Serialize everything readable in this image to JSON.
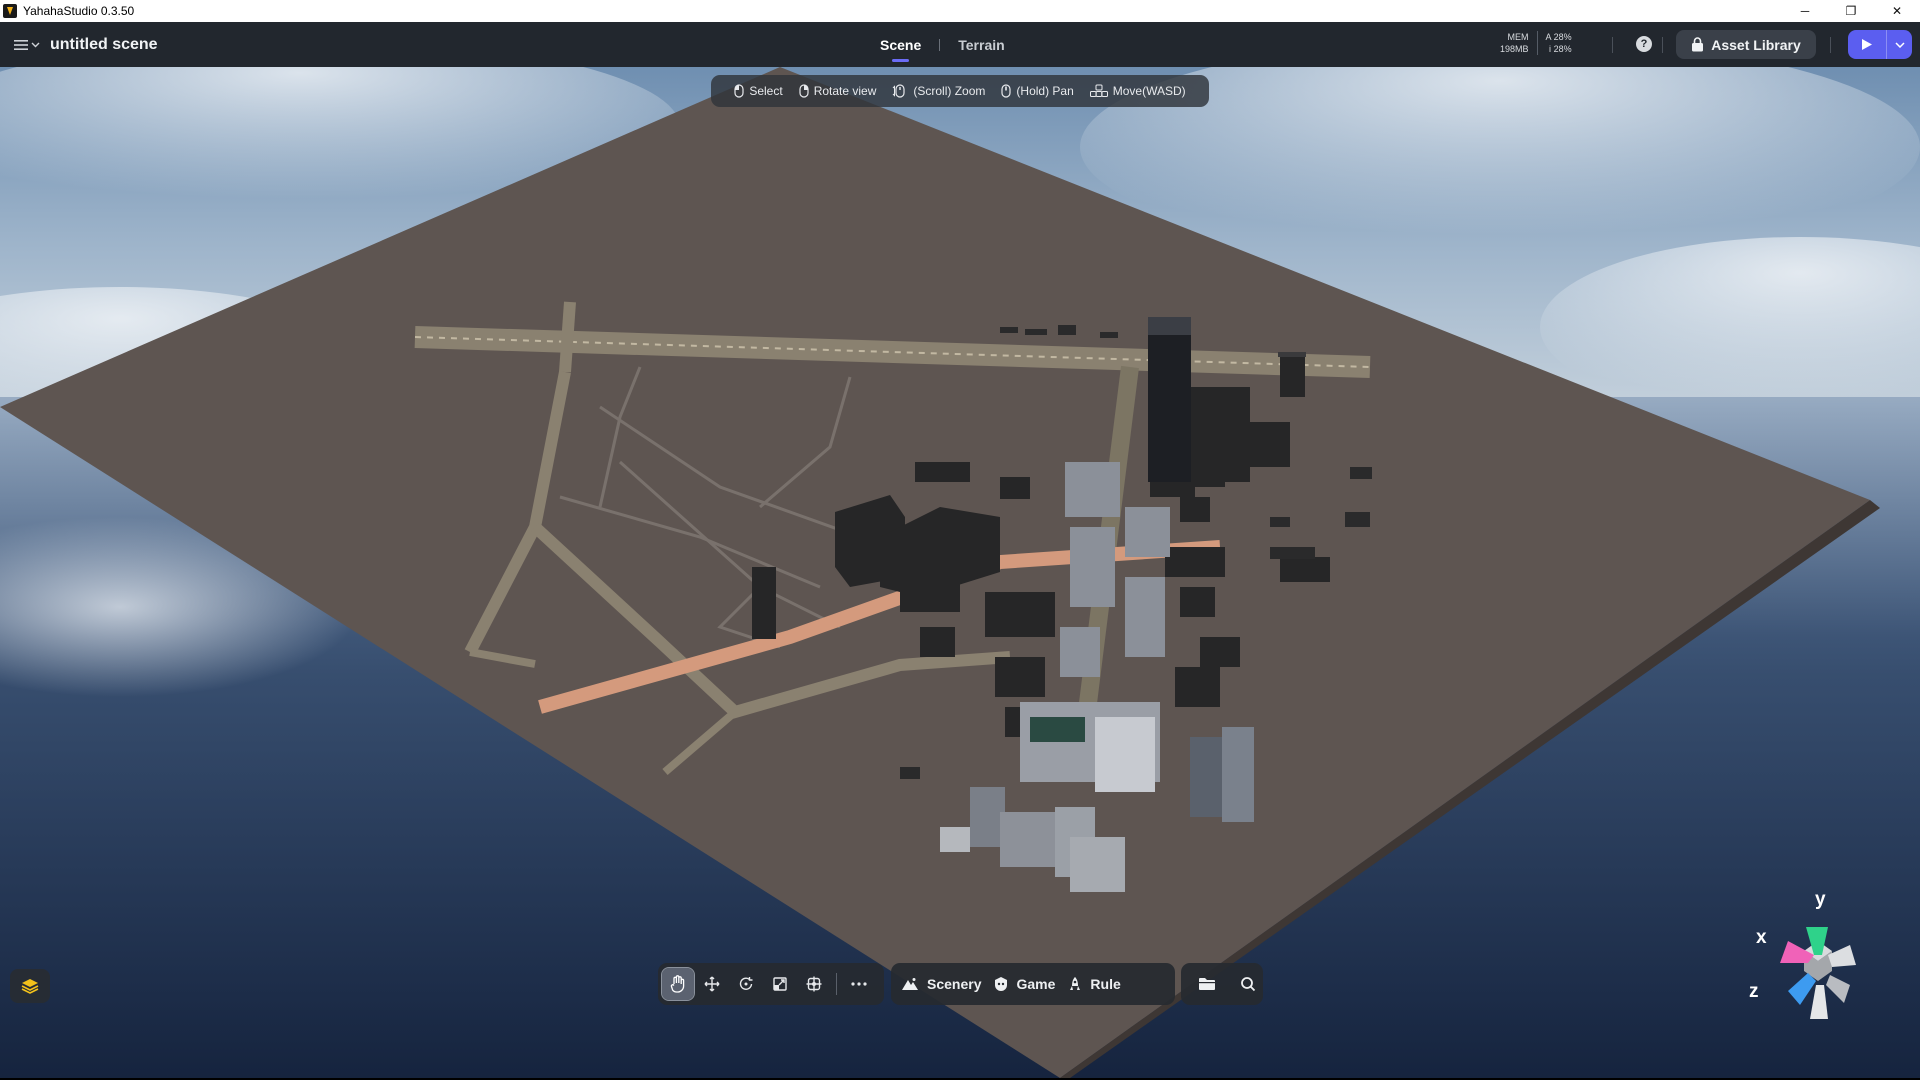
{
  "window": {
    "title": "YahahaStudio 0.3.50",
    "controls": [
      "─",
      "❐",
      "✕"
    ]
  },
  "header": {
    "scene_name": "untitled scene",
    "tabs": [
      {
        "label": "Scene",
        "active": true
      },
      {
        "label": "Terrain",
        "active": false
      }
    ],
    "stats": {
      "mem_label": "MEM",
      "mem_value": "198MB",
      "cpu_label": "A",
      "cpu_value": "28%",
      "gpu_label": "i",
      "gpu_value": "28%"
    },
    "help_label": "?",
    "asset_library_label": "Asset Library",
    "accent_color": "#5b5ef0"
  },
  "hints": [
    {
      "icon": "mouse-left-icon",
      "label": "Select"
    },
    {
      "icon": "mouse-right-icon",
      "label": "Rotate view"
    },
    {
      "icon": "mouse-scroll-icon",
      "label": "(Scroll) Zoom"
    },
    {
      "icon": "mouse-middle-icon",
      "label": "(Hold) Pan"
    },
    {
      "icon": "keyboard-icon",
      "label": "Move(WASD)"
    }
  ],
  "toolbar": {
    "tools": [
      "hand-icon",
      "move-icon",
      "rotate-icon",
      "scale-icon",
      "transform-icon",
      "more-icon"
    ],
    "modes": [
      {
        "icon": "scenery-icon",
        "label": "Scenery"
      },
      {
        "icon": "game-icon",
        "label": "Game"
      },
      {
        "icon": "rule-icon",
        "label": "Rule"
      }
    ],
    "files": [
      "folder-icon",
      "search-icon"
    ]
  },
  "gizmo": {
    "x_label": "x",
    "y_label": "y",
    "z_label": "z",
    "colors": {
      "x": "#f062b8",
      "y": "#2fd28a",
      "z": "#3d9bf0"
    }
  }
}
